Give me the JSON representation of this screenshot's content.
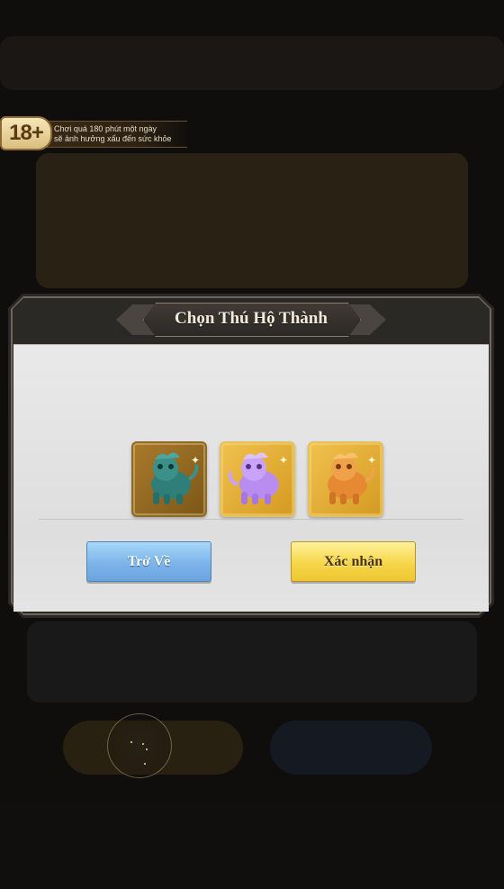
{
  "age_notice": {
    "badge": "18+",
    "line1": "Chơi quá 180 phút một ngày",
    "line2": "sẽ ảnh hưởng xấu đến sức khỏe"
  },
  "dialog": {
    "title": "Chọn Thú Hộ Thành",
    "pets": [
      {
        "name": "teal-guardian-lion",
        "color": "#2f7e78",
        "frame": "bronze"
      },
      {
        "name": "purple-guardian-lion",
        "color": "#b98cf0",
        "frame": "gold"
      },
      {
        "name": "orange-guardian-lion",
        "color": "#e58a33",
        "frame": "gold"
      }
    ],
    "back_label": "Trở Về",
    "confirm_label": "Xác nhận"
  },
  "colors": {
    "back_button": "#7cb5ea",
    "confirm_button": "#f6d64a",
    "panel": "#e3e3e3"
  }
}
